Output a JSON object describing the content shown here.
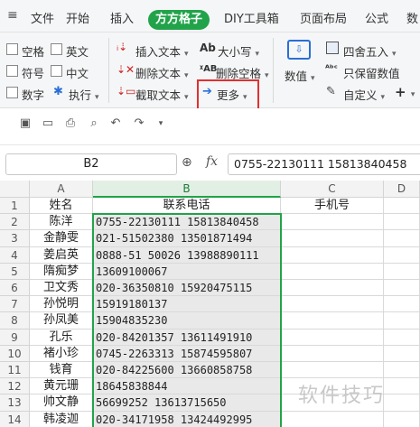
{
  "menu": {
    "file": "文件",
    "tabs": [
      "开始",
      "插入",
      "方方格子",
      "DIY工具箱",
      "页面布局",
      "公式",
      "数"
    ],
    "active_tab": "方方格子"
  },
  "ribbon": {
    "checkboxes": [
      "空格",
      "英文",
      "符号",
      "中文",
      "数字"
    ],
    "execute": "执行",
    "insert_text": "插入文本",
    "delete_text": "删除文本",
    "extract_text": "截取文本",
    "case": "大小写",
    "delete_space": "删除空格",
    "more": "更多",
    "values": "数值",
    "round": "四舍五入",
    "keep_values": "只保留数值",
    "custom": "自定义",
    "plus": "+"
  },
  "formula_bar": {
    "cell_ref": "B2",
    "fx": "fx",
    "value": "0755-22130111 15813840458"
  },
  "grid": {
    "columns": [
      "A",
      "B",
      "C",
      "D"
    ],
    "selected_column": "B",
    "header_row": [
      "姓名",
      "联系电话",
      "手机号"
    ],
    "rows": [
      {
        "n": "2",
        "name": "陈洋",
        "phone": "0755-22130111 15813840458"
      },
      {
        "n": "3",
        "name": "金静雯",
        "phone": "021-51502380 13501871494"
      },
      {
        "n": "4",
        "name": "姜启英",
        "phone": "0888-51 50026 13988890111"
      },
      {
        "n": "5",
        "name": "隋痴梦",
        "phone": "13609100067"
      },
      {
        "n": "6",
        "name": "卫文秀",
        "phone": "020-36350810 15920475115"
      },
      {
        "n": "7",
        "name": "孙悦明",
        "phone": "15919180137"
      },
      {
        "n": "8",
        "name": "孙凤美",
        "phone": "15904835230"
      },
      {
        "n": "9",
        "name": "孔乐",
        "phone": "020-84201357 13611491910"
      },
      {
        "n": "10",
        "name": "褚小珍",
        "phone": "0745-2263313 15874595807"
      },
      {
        "n": "11",
        "name": "钱育",
        "phone": "020-84225600 13660858758"
      },
      {
        "n": "12",
        "name": "黄元珊",
        "phone": "18645838844"
      },
      {
        "n": "13",
        "name": "帅文静",
        "phone": "56699252 13613715650"
      },
      {
        "n": "14",
        "name": "韩凌迦",
        "phone": "020-34171958 13424492995"
      }
    ]
  },
  "watermark": "软件技巧",
  "colors": {
    "accent": "#22a34a",
    "highlight": "#e03030"
  }
}
